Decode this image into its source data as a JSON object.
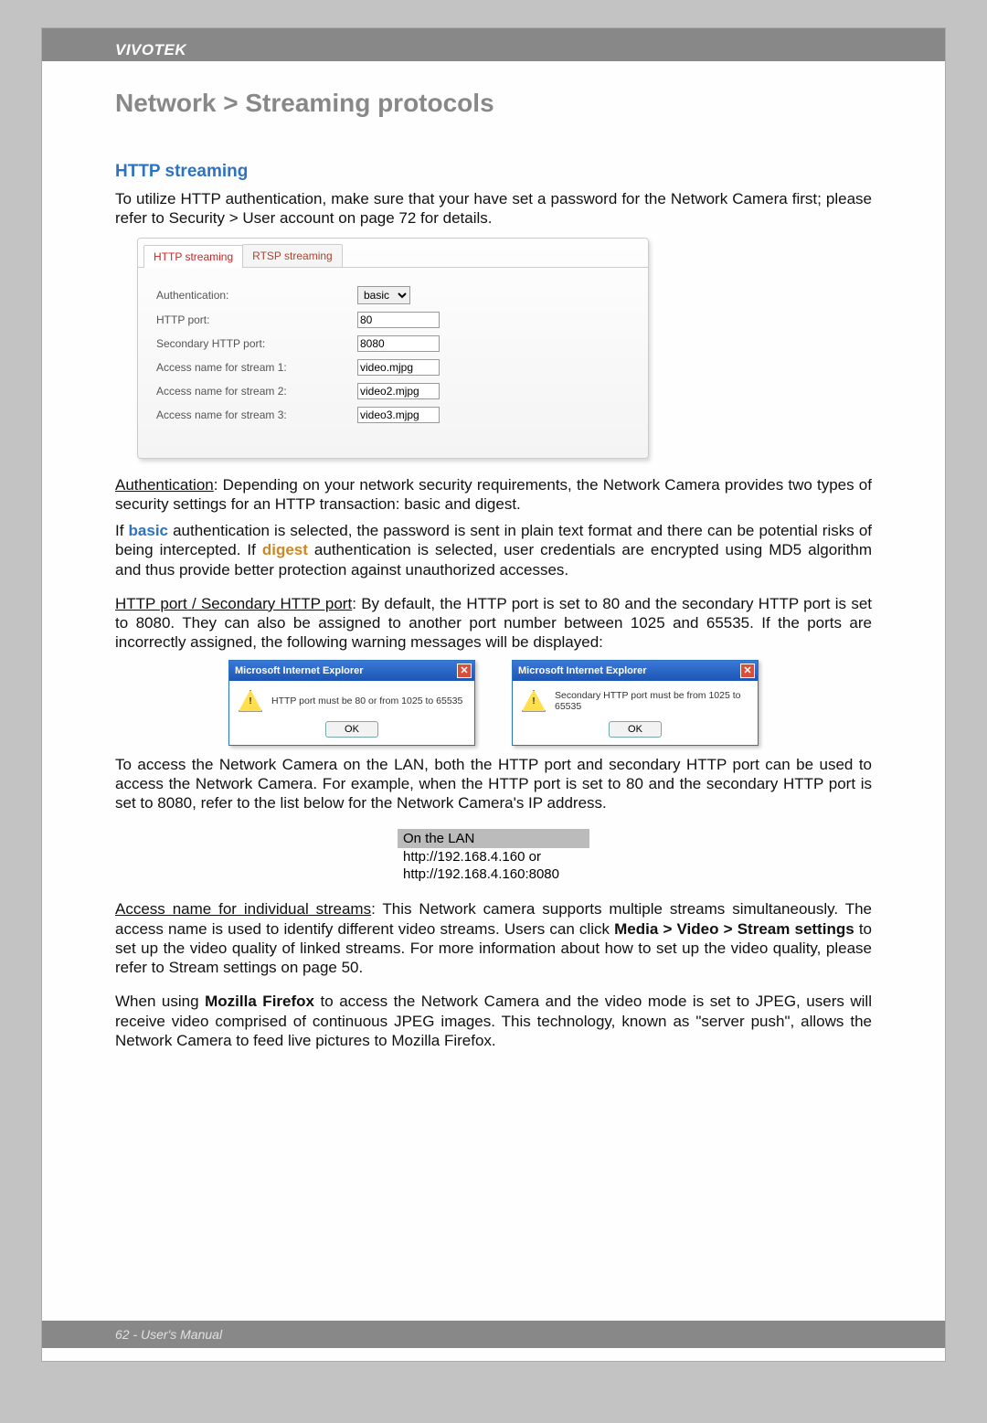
{
  "brand": "VIVOTEK",
  "title": "Network > Streaming protocols",
  "section_heading": "HTTP streaming",
  "intro": "To utilize HTTP authentication, make sure that your have set a password for the Network Camera first; please refer to Security > User account on page 72 for details.",
  "tabs": {
    "http": "HTTP streaming",
    "rtsp": "RTSP streaming"
  },
  "form": {
    "auth_label": "Authentication:",
    "auth_value": "basic",
    "http_port_label": "HTTP port:",
    "http_port_value": "80",
    "sec_port_label": "Secondary HTTP port:",
    "sec_port_value": "8080",
    "s1_label": "Access name for stream 1:",
    "s1_value": "video.mjpg",
    "s2_label": "Access name for stream 2:",
    "s2_value": "video2.mjpg",
    "s3_label": "Access name for stream 3:",
    "s3_value": "video3.mjpg"
  },
  "auth_head": "Authentication",
  "auth_body1": ": Depending on your network security requirements, the Network Camera provides two types of security settings for an HTTP transaction: basic and digest.",
  "auth_body2_pre": "If ",
  "auth_basic": "basic",
  "auth_body2_mid": " authentication is selected, the password is sent in plain text format and there can be potential risks of being intercepted. If ",
  "auth_digest": "digest",
  "auth_body2_post": " authentication is selected, user credentials are encrypted using MD5 algorithm and thus provide better protection against unauthorized accesses.",
  "ports_head": "HTTP port / Secondary HTTP port",
  "ports_body": ": By default, the HTTP port is set to 80 and the secondary HTTP port is set to 8080. They can also be assigned to another port number between 1025 and 65535. If the ports are incorrectly assigned, the following warning messages will be displayed:",
  "dialog": {
    "title": "Microsoft Internet Explorer",
    "msg1": "HTTP port must be 80 or from 1025 to 65535",
    "msg2": "Secondary HTTP port must be from 1025 to 65535",
    "ok": "OK"
  },
  "lan_intro": "To access the Network Camera on the LAN, both the HTTP port and secondary HTTP port can be used to access the Network Camera. For example, when the HTTP port is set to 80 and the secondary HTTP port is set to 8080, refer to the list below for the Network Camera's IP address.",
  "lan_table": {
    "head": "On the LAN",
    "row1": "http://192.168.4.160  or",
    "row2": "http://192.168.4.160:8080"
  },
  "access_head": "Access name for individual streams",
  "access_body1": ": This Network camera supports multiple streams simultaneously. The access name is used to identify different video streams. Users can click ",
  "access_bold": "Media > Video > Stream settings",
  "access_body2": " to set up the video quality of linked streams. For more information about how to set up the video quality, please refer to Stream settings on page 50.",
  "firefox_body1": "When using ",
  "firefox_bold": "Mozilla Firefox",
  "firefox_body2": " to access the Network Camera and the video mode is set to JPEG, users will receive video comprised of continuous JPEG images. This technology, known as \"server push\", allows the Network Camera to feed live pictures to Mozilla Firefox.",
  "footer": "62 - User's Manual"
}
